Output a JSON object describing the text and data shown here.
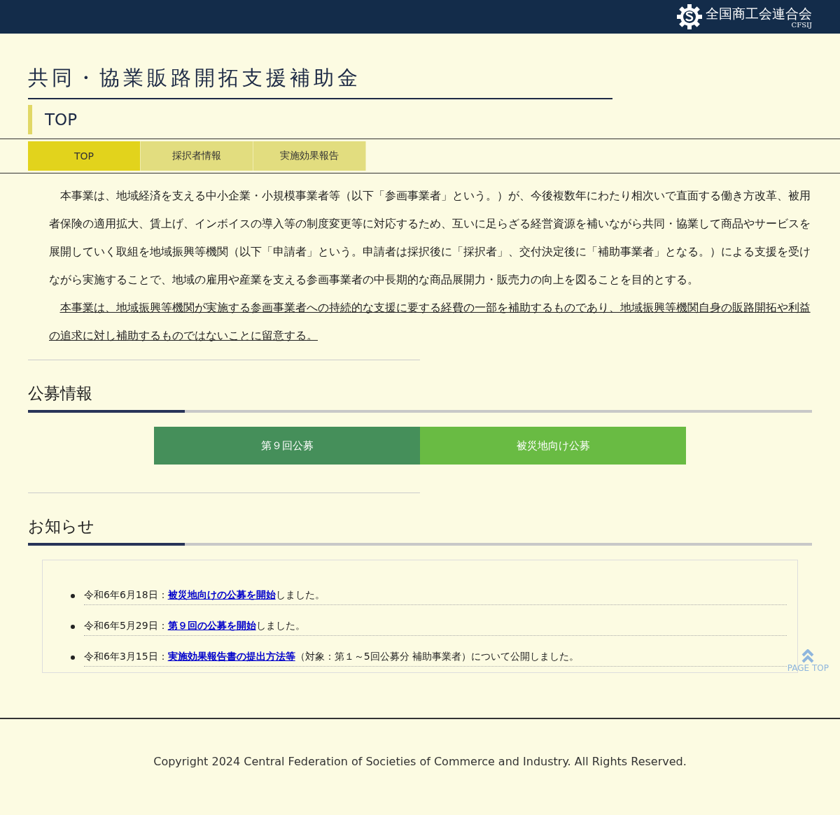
{
  "header": {
    "logo_text": "全国商工会連合会",
    "logo_sub": "CFSIJ"
  },
  "page_title": "共同・協業販路開拓支援補助金",
  "subtitle": "TOP",
  "tabs": [
    {
      "label": "TOP",
      "selected": true
    },
    {
      "label": "採択者情報",
      "selected": false
    },
    {
      "label": "実施効果報告",
      "selected": false
    }
  ],
  "intro": [
    {
      "kind": "body",
      "text": "本事業は、地域経済を支える中小企業・小規模事業者等（以下「参画事業者」という。）が、今後複数年にわたり相次いで直面する働き方改革、被用者保険の適用拡大、賃上げ、インボイスの導入等の制度変更等に対応するため、互いに足らざる経営資源を補いながら共同・協業して商品やサービスを展開していく取組を地域振興等機関（以下「申請者」という。申請者は採択後に「採択者」、交付決定後に「補助事業者」となる。）による支援を受けながら実施することで、地域の雇用や産業を支える参画事業者の中長期的な商品展開力・販売力の向上を図ることを目的とする。"
    },
    {
      "kind": "note",
      "text": "本事業は、地域振興等機関が実施する参画事業者への持続的な支援に要する経費の一部を補助するものであり、地域振興等機関自身の販路開拓や利益の追求に対し補助するものではないことに留意する。"
    }
  ],
  "recruitment": {
    "heading": "公募情報",
    "buttons": [
      {
        "label": "第９回公募",
        "color": "#458f5a"
      },
      {
        "label": "被災地向け公募",
        "color": "#69bb43"
      }
    ]
  },
  "news": {
    "heading": "お知らせ",
    "items": [
      {
        "date": "令和6年6月18日：",
        "link": "被災地向けの公募を開始",
        "rest": "しました。"
      },
      {
        "date": "令和6年5月29日：",
        "link": "第９回の公募を開始",
        "rest": "しました。"
      },
      {
        "date": "令和6年3月15日：",
        "link": "実施効果報告書の提出方法等",
        "rest": "（対象：第１～5回公募分 補助事業者）について公開しました。"
      }
    ]
  },
  "page_top": "PAGE TOP",
  "footer": "Copyright 2024 Central Federation of Societies of Commerce and Industry. All Rights Reserved."
}
